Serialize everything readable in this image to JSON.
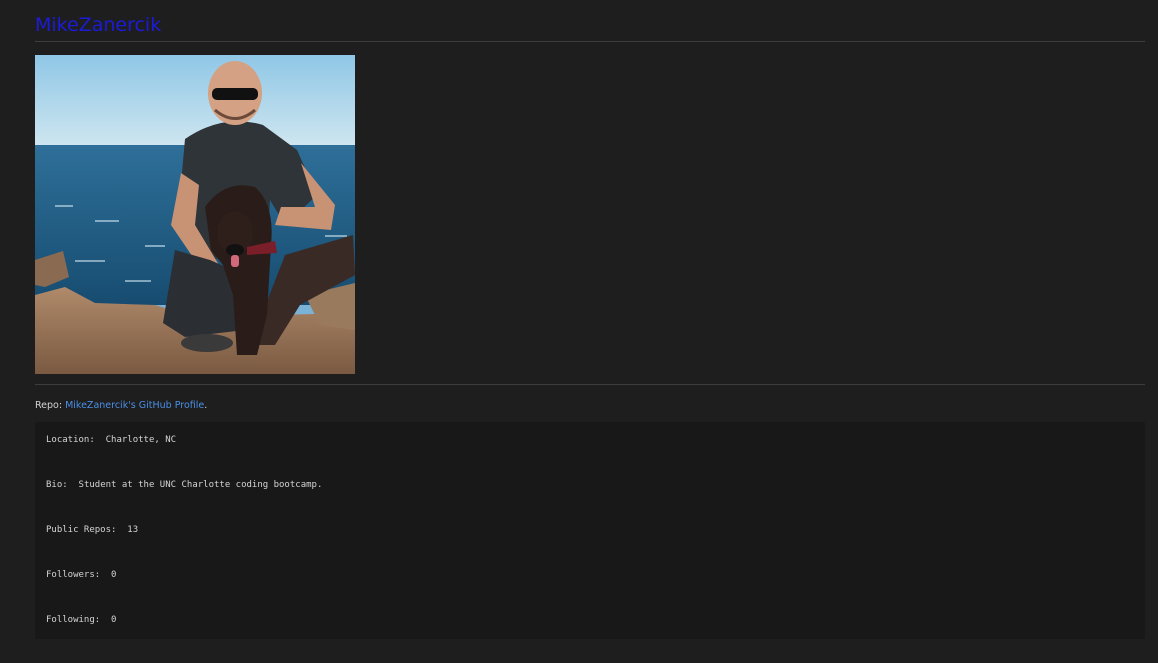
{
  "profile": {
    "name": "MikeZanercik",
    "photo_alt": "icon-avatar-photo"
  },
  "repo": {
    "prefix": "Repo:",
    "link_text": "MikeZanercik's GitHub Profile",
    "suffix": "."
  },
  "details": {
    "location_label": "Location:",
    "location_value": "Charlotte, NC",
    "bio_label": "Bio:",
    "bio_value": "Student at the UNC Charlotte coding bootcamp.",
    "repos_label": "Public Repos:",
    "repos_value": "13",
    "followers_label": "Followers:",
    "followers_value": "0",
    "following_label": "Following:",
    "following_value": "0"
  },
  "colors": {
    "background": "#1e1e1e",
    "title_link": "#1b1bd9",
    "profile_link": "#4a8fe7",
    "detail_panel": "#181818"
  }
}
